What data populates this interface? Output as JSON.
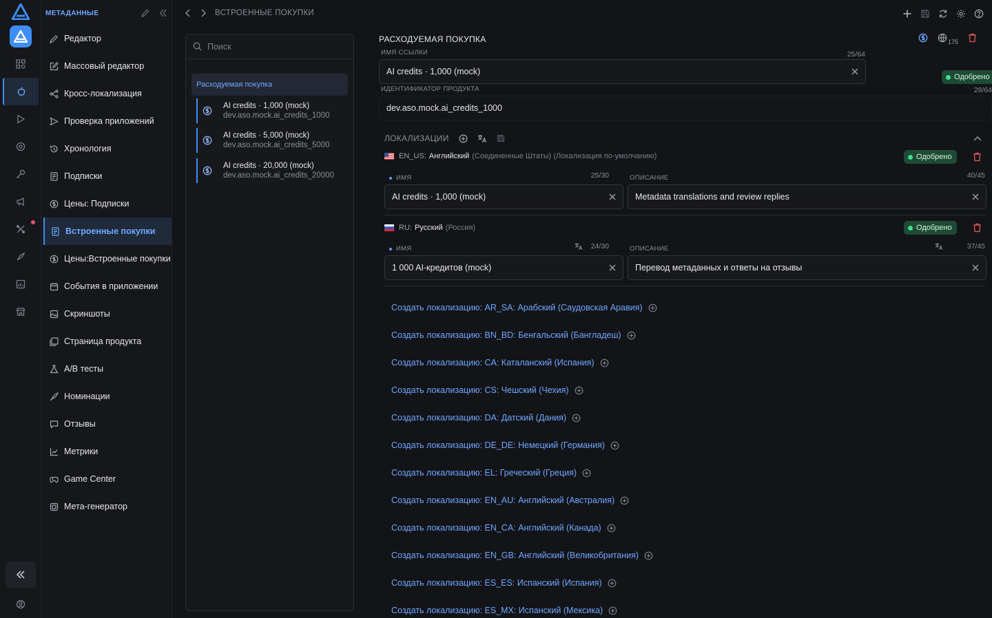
{
  "sidebar": {
    "header": "МЕТАДАННЫЕ",
    "items": [
      {
        "label": "Редактор",
        "icon": "pencil-icon"
      },
      {
        "label": "Массовый редактор",
        "icon": "edit-square-icon"
      },
      {
        "label": "Кросс-локализация",
        "icon": "share-icon"
      },
      {
        "label": "Проверка приложений",
        "icon": "send-icon"
      },
      {
        "label": "Хронология",
        "icon": "history-icon"
      },
      {
        "label": "Подписки",
        "icon": "receipt-icon"
      },
      {
        "label": "Цены: Подписки",
        "icon": "dollar-circle-icon"
      },
      {
        "label": "Встроенные покупки",
        "icon": "receipt-icon"
      },
      {
        "label": "Цены:Встроенные покупки",
        "icon": "dollar-circle-icon"
      },
      {
        "label": "События в приложении",
        "icon": "calendar-icon"
      },
      {
        "label": "Скриншоты",
        "icon": "image-icon"
      },
      {
        "label": "Страница продукта",
        "icon": "gallery-icon"
      },
      {
        "label": "A/B тесты",
        "icon": "flask-icon"
      },
      {
        "label": "Номинации",
        "icon": "rocket-icon"
      },
      {
        "label": "Отзывы",
        "icon": "chat-icon"
      },
      {
        "label": "Метрики",
        "icon": "chart-icon"
      },
      {
        "label": "Game Center",
        "icon": "gamepad-icon"
      },
      {
        "label": "Мета-генератор",
        "icon": "chip-icon"
      }
    ]
  },
  "breadcrumb": {
    "title": "ВСТРОЕННЫЕ ПОКУПКИ"
  },
  "list": {
    "search_placeholder": "Поиск",
    "group": "Расходуемая покупка",
    "products": [
      {
        "name": "AI credits · 1,000 (mock)",
        "id": "dev.aso.mock.ai_credits_1000"
      },
      {
        "name": "AI credits · 5,000 (mock)",
        "id": "dev.aso.mock.ai_credits_5000"
      },
      {
        "name": "AI credits · 20,000 (mock)",
        "id": "dev.aso.mock.ai_credits_20000"
      }
    ]
  },
  "detail": {
    "title": "РАСХОДУЕМАЯ ПОКУПКА",
    "globe_count": "175",
    "ref_label": "ИМЯ ССЫЛКИ",
    "ref_count": "25/64",
    "ref_value": "AI credits · 1,000 (mock)",
    "status": "Одобрено",
    "pid_label": "ИДЕНТИФИКАТОР ПРОДУКТА",
    "pid_count": "28/64",
    "pid_value": "dev.aso.mock.ai_credits_1000"
  },
  "localizations": {
    "header": "ЛОКАЛИЗАЦИИ",
    "name_label": "ИМЯ",
    "desc_label": "ОПИСАНИЕ",
    "items": [
      {
        "code": "EN_US:",
        "language": "Английский",
        "region": "(Соединенные Штаты) (Локализация по-умолчанию)",
        "status": "Одобрено",
        "name_count": "25/30",
        "name": "AI credits · 1,000 (mock)",
        "desc_count": "40/45",
        "desc": "Metadata translations and review replies"
      },
      {
        "code": "RU:",
        "language": "Русский",
        "region": "(Россия)",
        "status": "Одобрено",
        "name_count": "24/30",
        "name": "1 000 AI-кредитов (mock)",
        "desc_count": "37/45",
        "desc": "Перевод метаданных и ответы на отзывы"
      }
    ],
    "create": [
      "Создать локализацию: AR_SA: Арабский (Саудовская Аравия)",
      "Создать локализацию: BN_BD: Бенгальский (Бангладеш)",
      "Создать локализацию: CA: Каталанский (Испания)",
      "Создать локализацию: CS: Чешский (Чехия)",
      "Создать локализацию: DA: Датский (Дания)",
      "Создать локализацию: DE_DE: Немецкий (Германия)",
      "Создать локализацию: EL: Греческий (Греция)",
      "Создать локализацию: EN_AU: Английский (Австралия)",
      "Создать локализацию: EN_CA: Английский (Канада)",
      "Создать локализацию: EN_GB: Английский (Великобритания)",
      "Создать локализацию: ES_ES: Испанский (Испания)",
      "Создать локализацию: ES_MX: Испанский (Мексика)"
    ]
  },
  "colors": {
    "accent": "#3d8ef7",
    "approved": "#3ee08a",
    "danger": "#e25b5b"
  }
}
